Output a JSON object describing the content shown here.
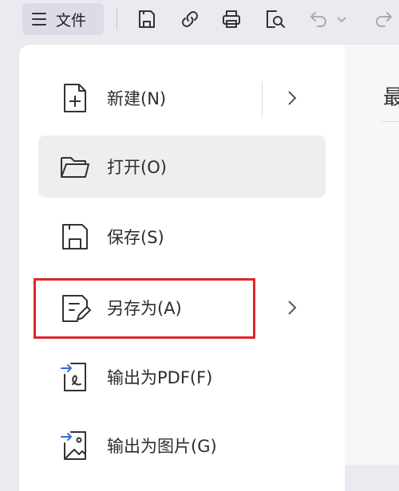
{
  "toolbar": {
    "file_label": "文件",
    "icons": [
      "menu-icon",
      "save-icon",
      "share-link-icon",
      "print-icon",
      "print-preview-icon",
      "undo-icon",
      "dropdown-icon",
      "redo-icon"
    ]
  },
  "menu": {
    "items": [
      {
        "label": "新建(N)",
        "icon": "new-document-icon",
        "has_submenu": true
      },
      {
        "label": "打开(O)",
        "icon": "folder-open-icon",
        "has_submenu": false,
        "selected": true
      },
      {
        "label": "保存(S)",
        "icon": "save-icon",
        "has_submenu": false
      },
      {
        "label": "另存为(A)",
        "icon": "save-as-icon",
        "has_submenu": true,
        "highlighted": true
      },
      {
        "label": "输出为PDF(F)",
        "icon": "export-pdf-icon",
        "has_submenu": false
      },
      {
        "label": "输出为图片(G)",
        "icon": "export-image-icon",
        "has_submenu": false
      }
    ]
  },
  "right_pane": {
    "title_fragment": "最"
  },
  "colors": {
    "highlight_border": "#e0262b",
    "selected_bg": "#eeeef0",
    "toolbar_bg": "#ece9f1"
  }
}
